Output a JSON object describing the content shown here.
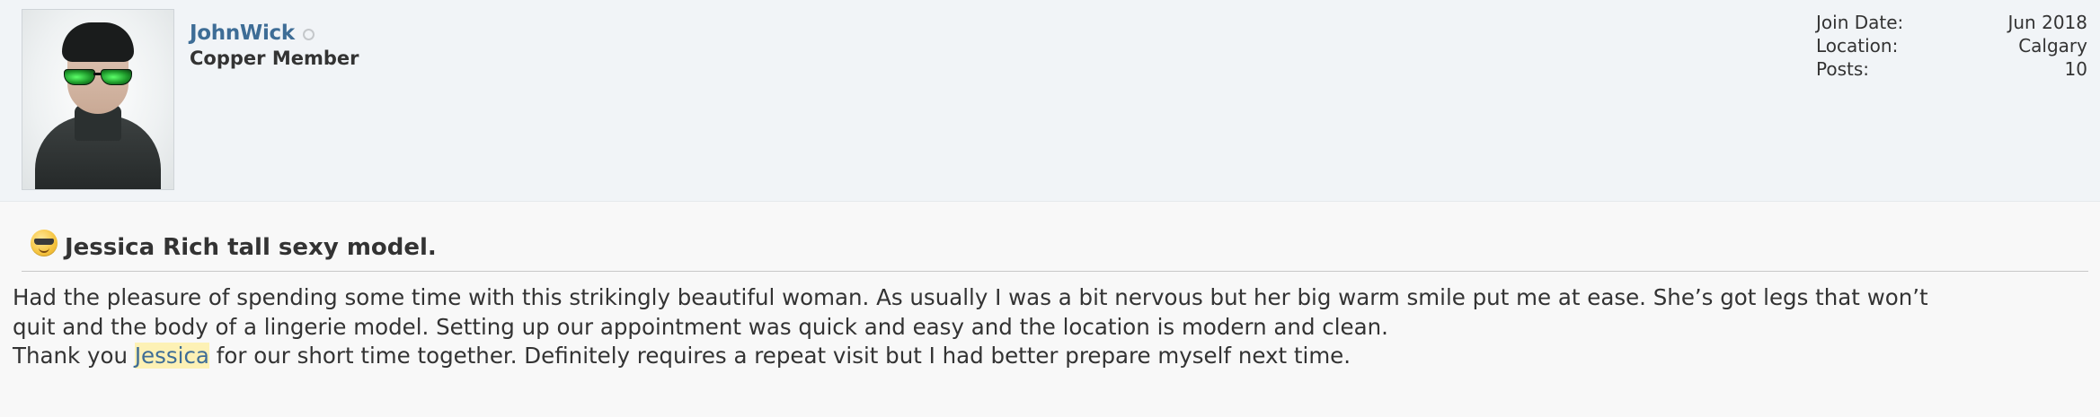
{
  "user": {
    "username": "JohnWick",
    "title": "Copper Member",
    "status": "offline",
    "avatar_icon": "user-avatar-image"
  },
  "user_info": [
    {
      "label": "Join Date:",
      "value": "Jun 2018"
    },
    {
      "label": "Location:",
      "value": "Calgary"
    },
    {
      "label": "Posts:",
      "value": "10"
    }
  ],
  "post": {
    "title_icon": "cool-smiley-icon",
    "title": "Jessica Rich tall sexy model.",
    "line1": "Had the pleasure of spending some time with this strikingly beautiful woman. As usually I was a bit nervous but her big warm smile put me at ease. She’s got legs that won’t",
    "line2": "quit and the body of a lingerie model. Setting up our appointment was quick and easy and the location is modern and clean.",
    "line3_before": "Thank you ",
    "line3_highlight": "Jessica",
    "line3_after": " for our short time together. Definitely requires a repeat visit but I had better prepare myself next time."
  },
  "colors": {
    "username": "#3e6d96",
    "header_bg": "#f1f4f7",
    "highlight_bg": "#fdf1b5"
  }
}
